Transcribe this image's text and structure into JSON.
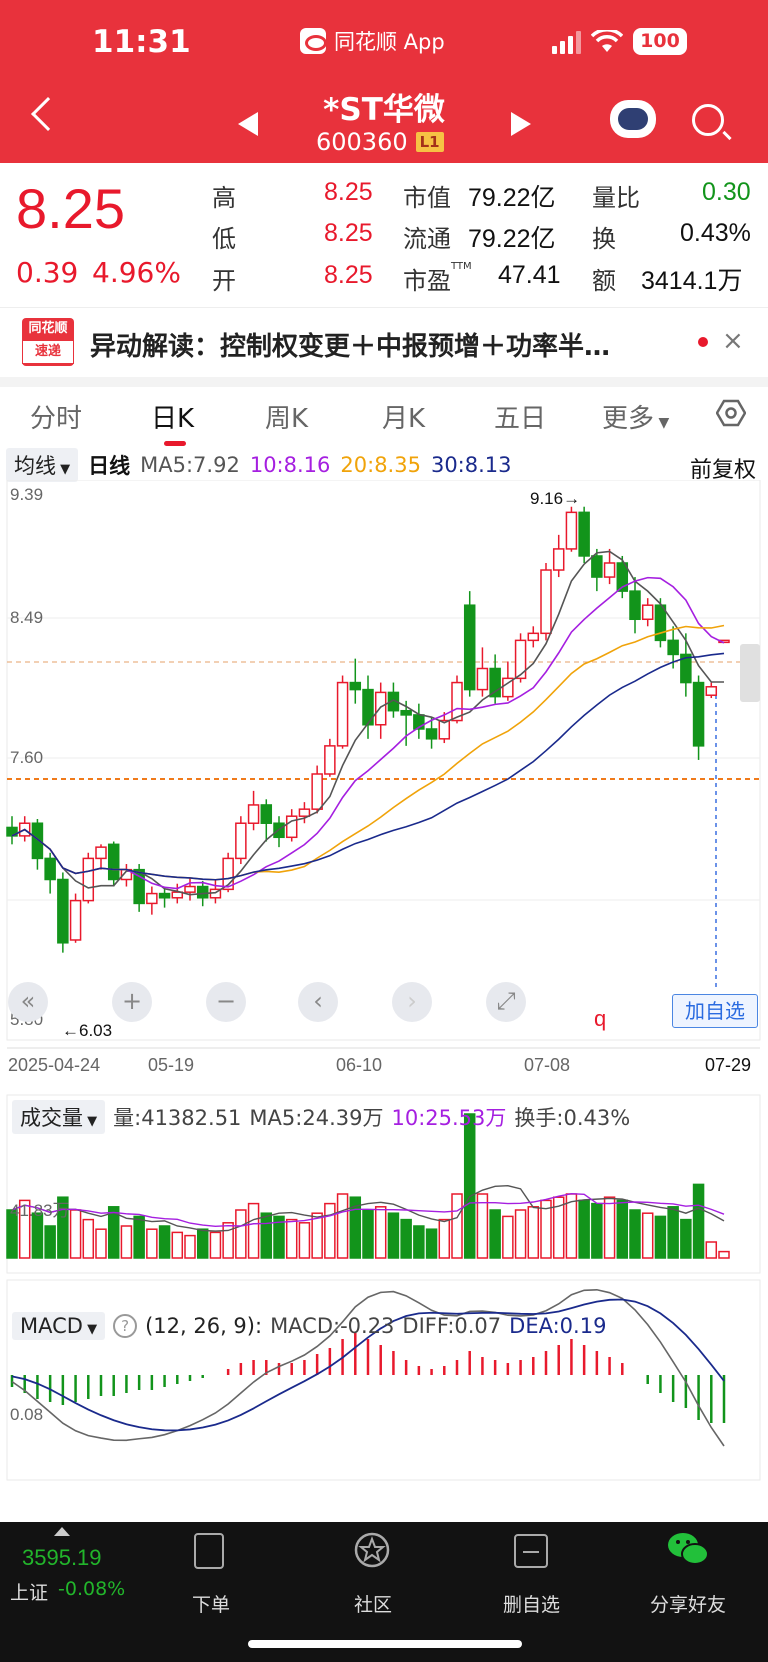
{
  "status_bar": {
    "time": "11:31",
    "app_name": "同花顺 App",
    "battery": "100"
  },
  "header": {
    "stock_name": "*ST华微",
    "stock_code": "600360",
    "level_badge": "L1"
  },
  "quote": {
    "price": "8.25",
    "change": "0.39",
    "change_pct": "4.96%",
    "high_label": "高",
    "high": "8.25",
    "low_label": "低",
    "low": "8.25",
    "open_label": "开",
    "open": "8.25",
    "mktcap_label": "市值",
    "mktcap": "79.22亿",
    "float_label": "流通",
    "float": "79.22亿",
    "pe_label": "市盈",
    "pe_sup": "TTM",
    "pe": "47.41",
    "volratio_label": "量比",
    "volratio": "0.30",
    "turnover_label": "换",
    "turnover": "0.43%",
    "amount_label": "额",
    "amount": "3414.1万"
  },
  "news": {
    "logo_top": "同花顺",
    "logo_bottom": "速递",
    "text": "异动解读：控制权变更＋中报预增＋功率半…"
  },
  "tabs": [
    "分时",
    "日K",
    "周K",
    "月K",
    "五日",
    "更多"
  ],
  "ma_row": {
    "dropdown": "均线",
    "period": "日线",
    "ma5": "MA5:7.92",
    "ma10": "10:8.16",
    "ma20": "20:8.35",
    "ma30": "30:8.13",
    "adjust": "前复权"
  },
  "chart_labels": {
    "y_top": "9.39",
    "y_mid": "8.49",
    "y_low": "7.60",
    "y_bottom": "5.80",
    "max_note": "9.16→",
    "min_note": "←6.03",
    "x_dates": [
      "2025-04-24",
      "05-19",
      "06-10",
      "07-08",
      "07-29"
    ],
    "q_mark": "q",
    "add_fav": "加自选",
    "vol_y": "41.83万",
    "macd_y": "0.08"
  },
  "vol_row": {
    "dropdown": "成交量",
    "vol": "量:41382.51",
    "ma5": "MA5:24.39万",
    "ma10": "10:25.53万",
    "turnover": "换手:0.43%"
  },
  "macd_row": {
    "dropdown": "MACD",
    "params": "(12, 26, 9):",
    "macd": "MACD:-0.23",
    "diff": "DIFF:0.07",
    "dea": "DEA:0.19"
  },
  "bottom_bar": {
    "index_value": "3595.19",
    "index_name": "上证",
    "index_chg": "-0.08%",
    "items": [
      "下单",
      "社区",
      "删自选",
      "分享好友"
    ]
  },
  "colors": {
    "up": "#e8192c",
    "down": "#12941b",
    "header_bg": "#e8323c",
    "ma5": "#555555",
    "ma10": "#a51fe0",
    "ma20": "#f0a30a",
    "ma30": "#1a2a8c"
  },
  "chart_data": {
    "type": "candlestick",
    "ylim": [
      5.8,
      9.39
    ],
    "max_point": 9.16,
    "min_point": 6.03,
    "bars": [
      [
        6.92,
        6.86,
        7.0,
        6.8
      ],
      [
        6.86,
        6.95,
        7.0,
        6.82
      ],
      [
        6.95,
        6.7,
        6.98,
        6.62
      ],
      [
        6.7,
        6.55,
        6.74,
        6.45
      ],
      [
        6.55,
        6.1,
        6.6,
        6.03
      ],
      [
        6.12,
        6.4,
        6.45,
        6.1
      ],
      [
        6.4,
        6.7,
        6.74,
        6.38
      ],
      [
        6.7,
        6.78,
        6.8,
        6.62
      ],
      [
        6.8,
        6.55,
        6.82,
        6.5
      ],
      [
        6.55,
        6.62,
        6.66,
        6.5
      ],
      [
        6.62,
        6.38,
        6.66,
        6.32
      ],
      [
        6.38,
        6.45,
        6.5,
        6.3
      ],
      [
        6.45,
        6.42,
        6.5,
        6.35
      ],
      [
        6.42,
        6.46,
        6.52,
        6.38
      ],
      [
        6.46,
        6.5,
        6.56,
        6.4
      ],
      [
        6.5,
        6.42,
        6.54,
        6.36
      ],
      [
        6.42,
        6.48,
        6.55,
        6.38
      ],
      [
        6.48,
        6.7,
        6.74,
        6.46
      ],
      [
        6.7,
        6.95,
        7.0,
        6.66
      ],
      [
        6.95,
        7.08,
        7.18,
        6.9
      ],
      [
        7.08,
        6.95,
        7.12,
        6.82
      ],
      [
        6.95,
        6.85,
        7.0,
        6.78
      ],
      [
        6.85,
        7.0,
        7.05,
        6.82
      ],
      [
        7.0,
        7.05,
        7.1,
        6.95
      ],
      [
        7.05,
        7.3,
        7.36,
        7.02
      ],
      [
        7.3,
        7.5,
        7.55,
        7.28
      ],
      [
        7.5,
        7.95,
        8.0,
        7.48
      ],
      [
        7.95,
        7.9,
        8.12,
        7.8
      ],
      [
        7.9,
        7.65,
        8.0,
        7.55
      ],
      [
        7.65,
        7.88,
        7.95,
        7.55
      ],
      [
        7.88,
        7.75,
        7.95,
        7.7
      ],
      [
        7.75,
        7.72,
        7.82,
        7.5
      ],
      [
        7.72,
        7.62,
        7.8,
        7.55
      ],
      [
        7.62,
        7.55,
        7.7,
        7.48
      ],
      [
        7.55,
        7.68,
        7.74,
        7.52
      ],
      [
        7.68,
        7.95,
        8.0,
        7.66
      ],
      [
        8.5,
        7.9,
        8.6,
        7.85
      ],
      [
        7.9,
        8.05,
        8.2,
        7.85
      ],
      [
        8.05,
        7.85,
        8.15,
        7.8
      ],
      [
        7.85,
        7.98,
        8.1,
        7.82
      ],
      [
        7.98,
        8.25,
        8.3,
        7.95
      ],
      [
        8.25,
        8.3,
        8.35,
        8.2
      ],
      [
        8.3,
        8.75,
        8.8,
        8.25
      ],
      [
        8.75,
        8.9,
        9.0,
        8.7
      ],
      [
        8.9,
        9.16,
        9.2,
        8.88
      ],
      [
        9.16,
        8.85,
        9.2,
        8.8
      ],
      [
        8.85,
        8.7,
        8.9,
        8.6
      ],
      [
        8.7,
        8.8,
        8.9,
        8.65
      ],
      [
        8.8,
        8.6,
        8.85,
        8.55
      ],
      [
        8.6,
        8.4,
        8.7,
        8.3
      ],
      [
        8.4,
        8.5,
        8.55,
        8.35
      ],
      [
        8.5,
        8.25,
        8.55,
        8.2
      ],
      [
        8.25,
        8.15,
        8.35,
        8.05
      ],
      [
        8.15,
        7.95,
        8.3,
        7.85
      ],
      [
        7.95,
        7.5,
        8.0,
        7.4
      ],
      [
        7.86,
        7.92,
        7.95,
        7.84
      ],
      [
        8.25,
        8.25,
        8.25,
        8.25
      ]
    ],
    "volume": [
      30,
      36,
      28,
      20,
      38,
      30,
      24,
      18,
      32,
      20,
      26,
      18,
      20,
      16,
      14,
      18,
      16,
      22,
      30,
      34,
      28,
      26,
      24,
      22,
      28,
      34,
      40,
      38,
      30,
      32,
      28,
      24,
      20,
      18,
      24,
      40,
      90,
      40,
      30,
      26,
      30,
      32,
      36,
      38,
      40,
      36,
      34,
      38,
      36,
      30,
      28,
      26,
      32,
      24,
      46,
      10,
      4
    ],
    "macd_hist": [
      -0.04,
      -0.06,
      -0.08,
      -0.09,
      -0.1,
      -0.09,
      -0.08,
      -0.07,
      -0.07,
      -0.06,
      -0.05,
      -0.05,
      -0.04,
      -0.03,
      -0.02,
      -0.01,
      0.0,
      0.02,
      0.04,
      0.05,
      0.05,
      0.04,
      0.04,
      0.05,
      0.07,
      0.09,
      0.12,
      0.14,
      0.12,
      0.1,
      0.08,
      0.05,
      0.03,
      0.02,
      0.03,
      0.05,
      0.08,
      0.06,
      0.05,
      0.04,
      0.05,
      0.06,
      0.08,
      0.1,
      0.12,
      0.1,
      0.08,
      0.06,
      0.04,
      0.0,
      -0.03,
      -0.06,
      -0.09,
      -0.11,
      -0.15,
      -0.16,
      -0.16
    ]
  }
}
